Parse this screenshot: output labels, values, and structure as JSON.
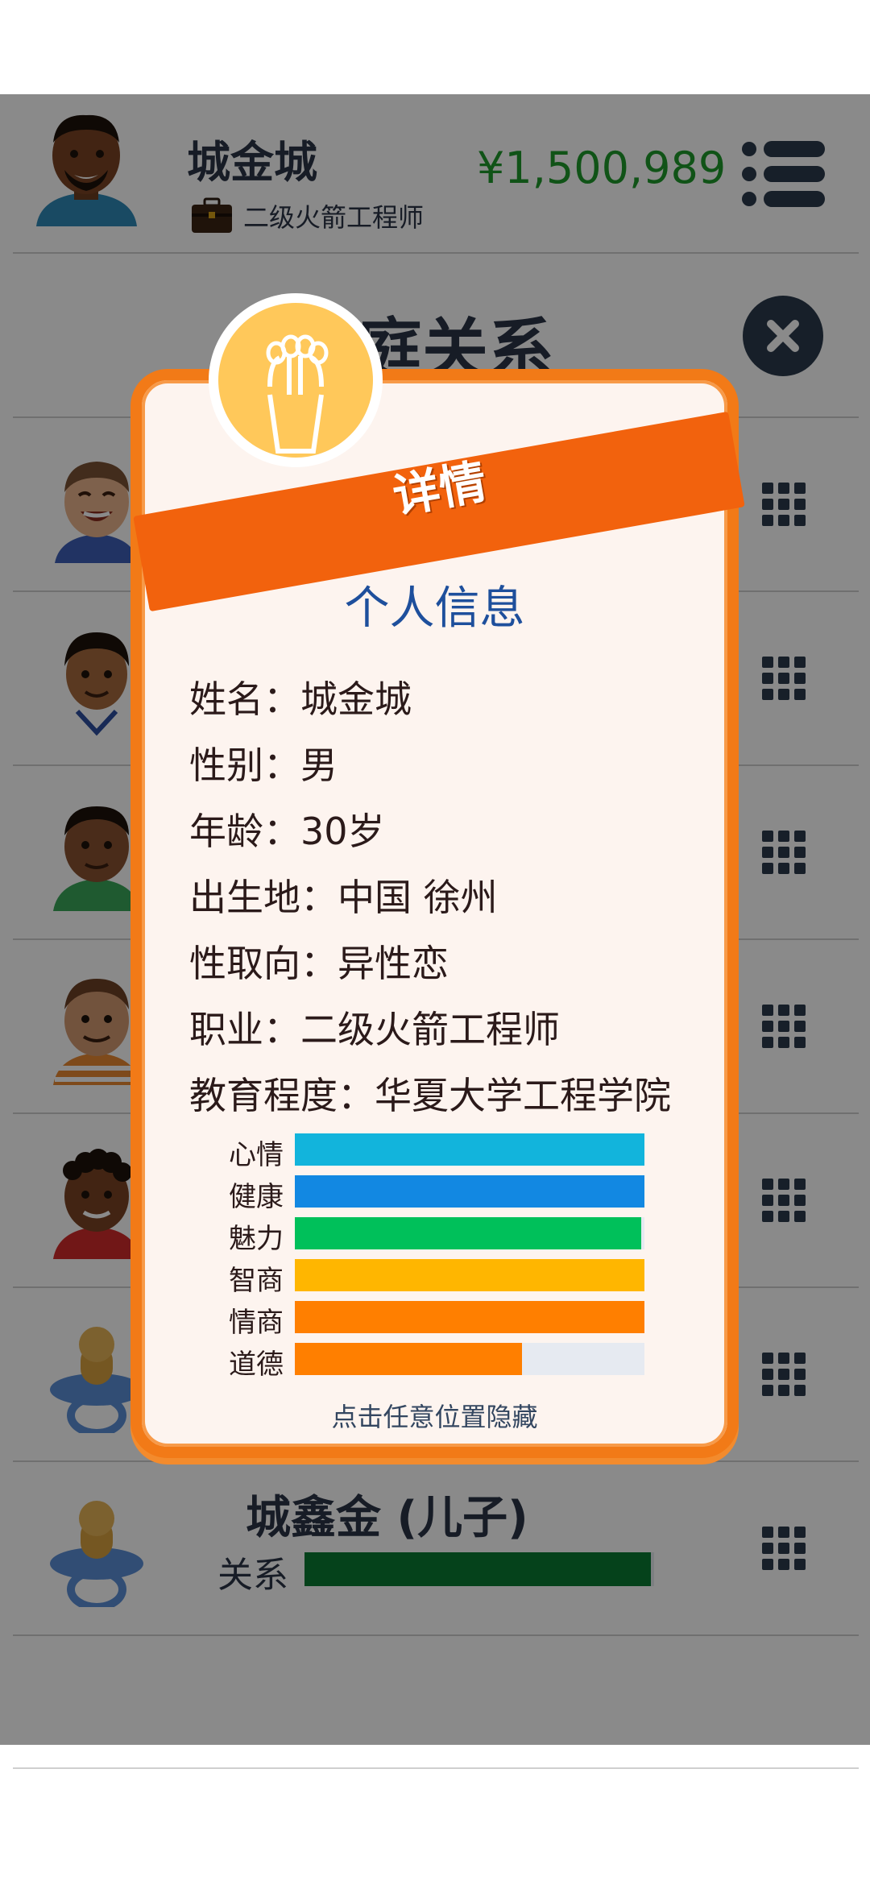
{
  "header": {
    "player_name": "城金城",
    "job": "二级火箭工程师",
    "money": "¥1,500,989"
  },
  "section": {
    "title": "家庭关系"
  },
  "family_list": [
    {
      "name": "",
      "avatar": "laughing-boy"
    },
    {
      "name": "",
      "avatar": "sailor-boy"
    },
    {
      "name": "",
      "avatar": "green-shirt-man"
    },
    {
      "name": "",
      "avatar": "striped-shirt-man"
    },
    {
      "name": "",
      "avatar": "curly-hair-man"
    },
    {
      "name": "",
      "avatar": "pacifier"
    },
    {
      "name": "城鑫金 (儿子)",
      "avatar": "pacifier",
      "relation_label": "关系",
      "relation_level": 0.99
    }
  ],
  "modal": {
    "banner": "详情",
    "title": "个人信息",
    "info": [
      {
        "label": "姓名",
        "value": "城金城"
      },
      {
        "label": "性别",
        "value": "男"
      },
      {
        "label": "年龄",
        "value": "30岁"
      },
      {
        "label": "出生地",
        "value": "中国 徐州"
      },
      {
        "label": "性取向",
        "value": "异性恋"
      },
      {
        "label": "职业",
        "value": "二级火箭工程师"
      },
      {
        "label": "教育程度",
        "value": "华夏大学工程学院"
      }
    ],
    "stats": [
      {
        "label": "心情",
        "level": 1.0,
        "color": "#12b4dc"
      },
      {
        "label": "健康",
        "level": 1.0,
        "color": "#1288e2"
      },
      {
        "label": "魅力",
        "level": 0.99,
        "color": "#00c05a"
      },
      {
        "label": "智商",
        "level": 1.0,
        "color": "#ffb600"
      },
      {
        "label": "情商",
        "level": 1.0,
        "color": "#ff7f00"
      },
      {
        "label": "道德",
        "level": 0.65,
        "color": "#ff7f00"
      }
    ],
    "hint": "点击任意位置隐藏"
  }
}
